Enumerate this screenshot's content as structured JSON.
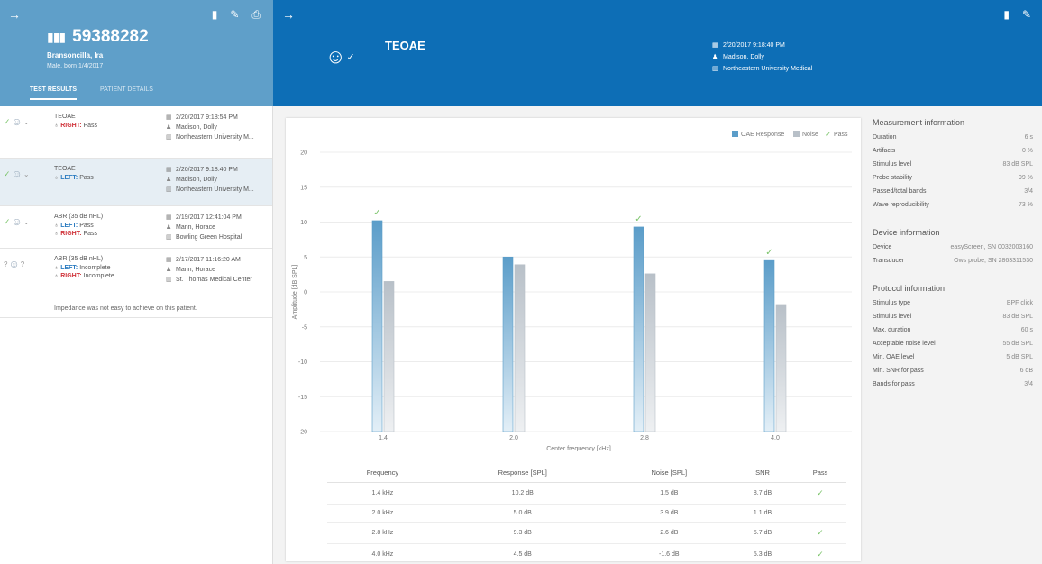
{
  "left_header": {
    "patient_id": "59388282",
    "patient_name": "Bransoncilla, Ira",
    "patient_meta": "Male, born 1/4/2017",
    "tabs": [
      {
        "label": "TEST RESULTS"
      },
      {
        "label": "PATIENT DETAILS"
      }
    ]
  },
  "tests": [
    {
      "name": "TEOAE",
      "sides": [
        {
          "label": "RIGHT:",
          "value": "Pass"
        }
      ],
      "date": "2/20/2017 9:18:54 PM",
      "examiner": "Madison, Dolly",
      "location": "Northeastern University M...",
      "status_icon": "pass",
      "note": ""
    },
    {
      "name": "TEOAE",
      "sides": [
        {
          "label": "LEFT:",
          "value": "Pass"
        }
      ],
      "date": "2/20/2017 9:18:40 PM",
      "examiner": "Madison, Dolly",
      "location": "Northeastern University M...",
      "status_icon": "pass",
      "note": ""
    },
    {
      "name": "ABR (35 dB nHL)",
      "sides": [
        {
          "label": "LEFT:",
          "value": "Pass"
        },
        {
          "label": "RIGHT:",
          "value": "Pass"
        }
      ],
      "date": "2/19/2017 12:41:04 PM",
      "examiner": "Mann, Horace",
      "location": "Bowling Green Hospital",
      "status_icon": "pass",
      "note": ""
    },
    {
      "name": "ABR (35 dB nHL)",
      "sides": [
        {
          "label": "LEFT:",
          "value": "Incomplete"
        },
        {
          "label": "RIGHT:",
          "value": "Incomplete"
        }
      ],
      "date": "2/17/2017 11:16:20 AM",
      "examiner": "Mann, Horace",
      "location": "St. Thomas Medical Center",
      "status_icon": "unknown",
      "note": "Impedance was not easy to achieve on this patient."
    }
  ],
  "test_header": {
    "title": "TEOAE",
    "date": "2/20/2017 9:18:40 PM",
    "examiner": "Madison, Dolly",
    "location": "Northeastern University Medical"
  },
  "chart_data": {
    "type": "bar",
    "categories": [
      "1.4",
      "2.0",
      "2.8",
      "4.0"
    ],
    "series": [
      {
        "name": "OAE Response",
        "values": [
          10.2,
          5.0,
          9.3,
          4.5
        ]
      },
      {
        "name": "Noise",
        "values": [
          1.5,
          3.9,
          2.6,
          -1.8
        ]
      }
    ],
    "pass": [
      true,
      false,
      true,
      true
    ],
    "legend": [
      "OAE Response",
      "Noise",
      "Pass"
    ],
    "legend_position": "top-right",
    "xlabel": "Center frequency [kHz]",
    "ylabel": "Amplitude [dB SPL]",
    "ylim": [
      -20,
      20
    ],
    "yticks": [
      20,
      15,
      10,
      5,
      0,
      -5,
      -10,
      -15,
      -20
    ],
    "grid": true,
    "colors": {
      "response": "#5b9dc9",
      "noise": "#b8c0c8",
      "pass": "#7bc46a"
    }
  },
  "table": {
    "headers": [
      "Frequency",
      "Response [SPL]",
      "Noise [SPL]",
      "SNR",
      "Pass"
    ],
    "rows": [
      [
        "1.4 kHz",
        "10.2 dB",
        "1.5 dB",
        "8.7 dB",
        "✓"
      ],
      [
        "2.0 kHz",
        "5.0 dB",
        "3.9 dB",
        "1.1 dB",
        ""
      ],
      [
        "2.8 kHz",
        "9.3 dB",
        "2.6 dB",
        "5.7 dB",
        "✓"
      ],
      [
        "4.0 kHz",
        "4.5 dB",
        "-1.6 dB",
        "5.3 dB",
        "✓"
      ]
    ]
  },
  "info": {
    "measurement": {
      "title": "Measurement information",
      "rows": [
        [
          "Duration",
          "6 s"
        ],
        [
          "Artifacts",
          "0 %"
        ],
        [
          "Stimulus level",
          "83 dB SPL"
        ],
        [
          "Probe stability",
          "99 %"
        ],
        [
          "Passed/total bands",
          "3/4"
        ],
        [
          "Wave reproducibility",
          "73 %"
        ]
      ]
    },
    "device": {
      "title": "Device information",
      "rows": [
        [
          "Device",
          "easyScreen, SN 0032003160"
        ],
        [
          "Transducer",
          "Ows probe, SN 2863311530"
        ]
      ]
    },
    "protocol": {
      "title": "Protocol information",
      "rows": [
        [
          "Stimulus type",
          "BPF click"
        ],
        [
          "Stimulus level",
          "83 dB SPL"
        ],
        [
          "Max. duration",
          "60 s"
        ],
        [
          "Acceptable noise level",
          "55 dB SPL"
        ],
        [
          "Min. OAE level",
          "5 dB SPL"
        ],
        [
          "Min. SNR for pass",
          "6 dB"
        ],
        [
          "Bands for pass",
          "3/4"
        ]
      ]
    }
  }
}
